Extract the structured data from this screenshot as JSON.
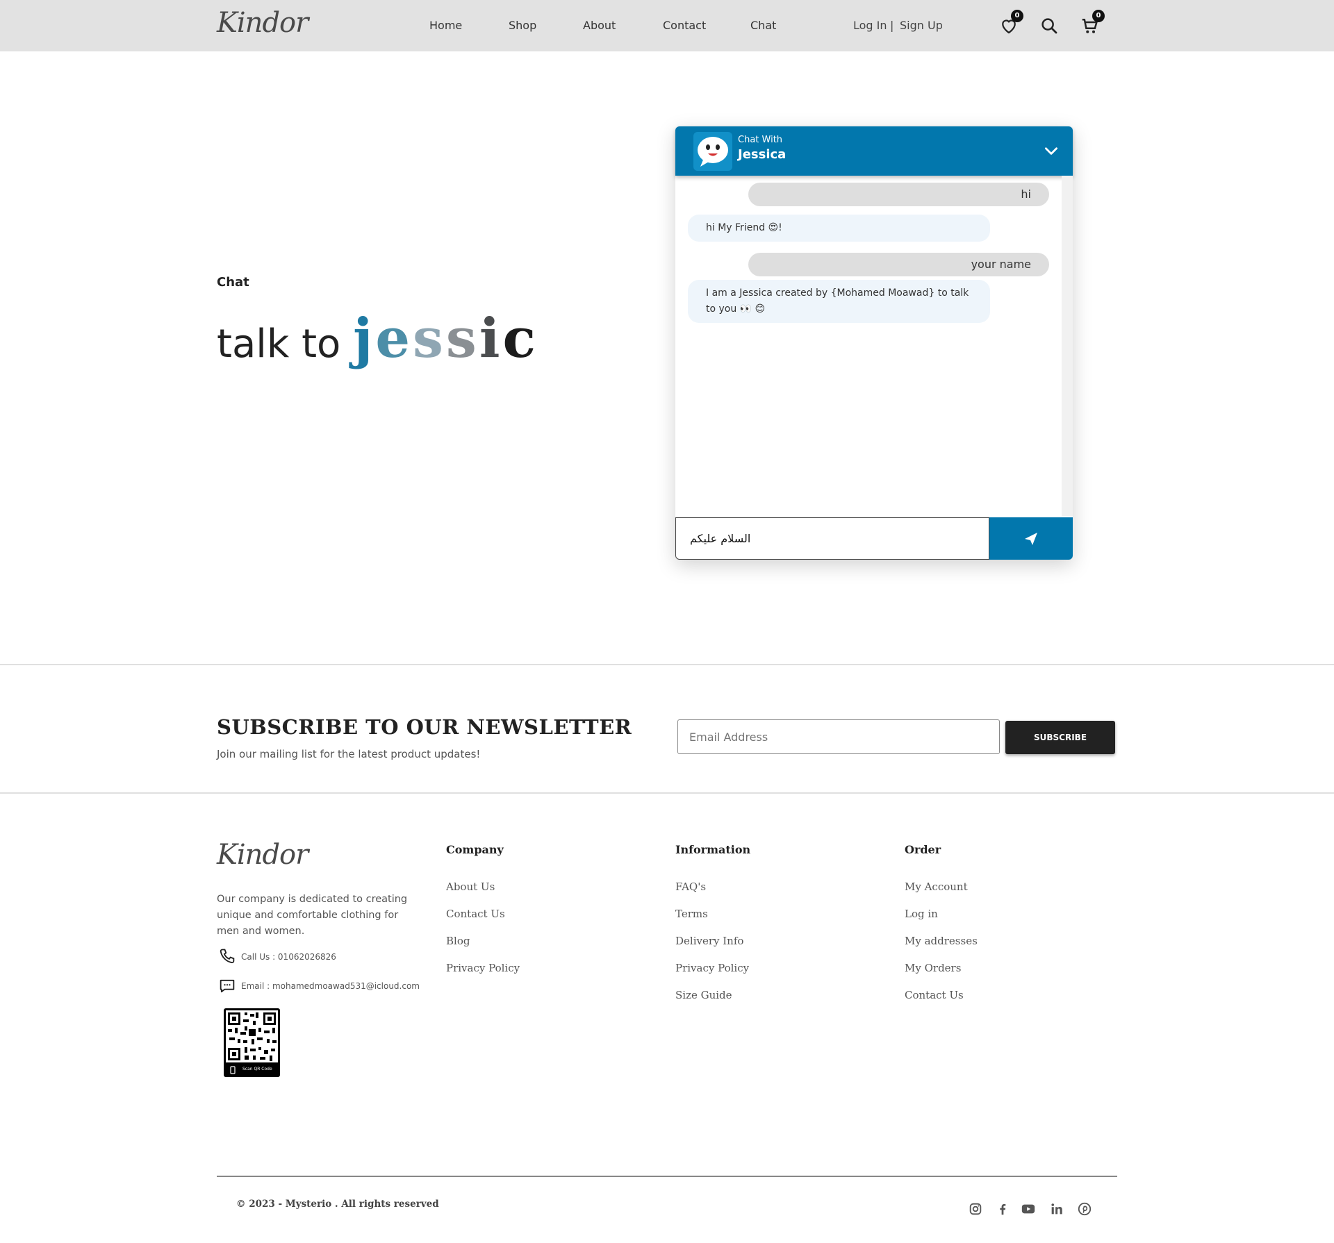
{
  "header": {
    "logo": "Kindor",
    "nav": [
      "Home",
      "Shop",
      "About",
      "Contact",
      "Chat"
    ],
    "login": "Log In",
    "separator": "|",
    "signup": "Sign Up",
    "wishlist_count": "0",
    "cart_count": "0"
  },
  "hero": {
    "label": "Chat",
    "title_prefix": "talk to",
    "name_letters": [
      "j",
      "e",
      "s",
      "s",
      "i",
      "c"
    ],
    "name_colors": [
      "#1f7aa3",
      "#4c8ea8",
      "#8fa6b3",
      "#8a8f93",
      "#4b4d4f",
      "#1c1c1c"
    ]
  },
  "chat": {
    "header_small": "Chat With",
    "header_name": "Jessica",
    "messages": [
      {
        "from": "user",
        "text": "hi"
      },
      {
        "from": "bot",
        "text": "hi My Friend 😍!"
      },
      {
        "from": "user",
        "text": "your name"
      },
      {
        "from": "bot",
        "text": "I am a Jessica created by {Mohamed Moawad} to talk to you 👀 😊"
      }
    ],
    "input_value": "السلام عليكم",
    "accent": "#0277ad"
  },
  "newsletter": {
    "title": "SUBSCRIBE TO OUR NEWSLETTER",
    "subtitle": "Join our mailing list for the latest product updates!",
    "placeholder": "Email Address",
    "button": "SUBSCRIBE"
  },
  "footer": {
    "logo": "Kindor",
    "description": "Our company is dedicated to creating unique and comfortable clothing for men and women.",
    "phone": "Call Us : 01062026826",
    "email": "Email : mohamedmoawad531@icloud.com",
    "qr_caption": "Scan QR Code",
    "columns": [
      {
        "title": "Company",
        "links": [
          "About Us",
          "Contact Us",
          "Blog",
          "Privacy Policy"
        ]
      },
      {
        "title": "Information",
        "links": [
          "FAQ's",
          "Terms",
          "Delivery Info",
          "Privacy Policy",
          "Size Guide"
        ]
      },
      {
        "title": "Order",
        "links": [
          "My Account",
          "Log in",
          "My addresses",
          "My Orders",
          "Contact Us"
        ]
      }
    ],
    "copyright": "© 2023 - Mysterio . All rights reserved",
    "social": [
      "instagram-icon",
      "facebook-icon",
      "youtube-icon",
      "linkedin-icon",
      "pinterest-icon"
    ]
  }
}
